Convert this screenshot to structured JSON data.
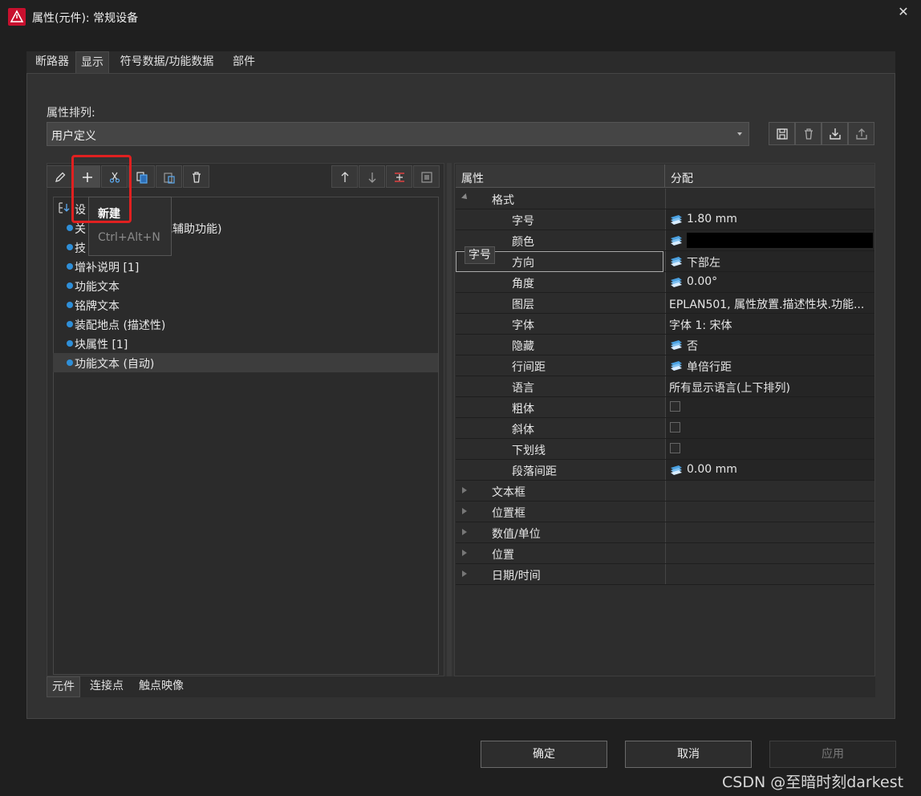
{
  "window": {
    "title": "属性(元件): 常规设备",
    "close": "✕"
  },
  "tabs": [
    "断路器",
    "显示",
    "符号数据/功能数据",
    "部件"
  ],
  "sort": {
    "label": "属性排列:",
    "value": "用户定义"
  },
  "tooltip": {
    "title": "新建",
    "shortcut": "Ctrl+Alt+N"
  },
  "tree": {
    "root_label": "设",
    "items": [
      "关",
      "技",
      "增补说明 [1]",
      "功能文本",
      "铭牌文本",
      "装配地点 (描述性)",
      "块属性 [1]",
      "功能文本 (自动)"
    ],
    "partial_item_suffix": "或辅助功能)"
  },
  "bottom_tabs": [
    "元件",
    "连接点",
    "触点映像"
  ],
  "grid": {
    "col_property": "属性",
    "col_value": "分配",
    "hover_tip": "字号",
    "rows": [
      {
        "name": "格式",
        "value": ""
      },
      {
        "name": "字号",
        "value": "1.80 mm"
      },
      {
        "name": "颜色",
        "value": ""
      },
      {
        "name": "方向",
        "value": "下部左"
      },
      {
        "name": "角度",
        "value": "0.00°"
      },
      {
        "name": "图层",
        "value": "EPLAN501, 属性放置.描述性块.功能..."
      },
      {
        "name": "字体",
        "value": "字体 1: 宋体"
      },
      {
        "name": "隐藏",
        "value": "否"
      },
      {
        "name": "行间距",
        "value": "单倍行距"
      },
      {
        "name": "语言",
        "value": "所有显示语言(上下排列)"
      },
      {
        "name": "粗体",
        "value": ""
      },
      {
        "name": "斜体",
        "value": ""
      },
      {
        "name": "下划线",
        "value": ""
      },
      {
        "name": "段落间距",
        "value": "0.00 mm"
      },
      {
        "name": "文本框",
        "value": ""
      },
      {
        "name": "位置框",
        "value": ""
      },
      {
        "name": "数值/单位",
        "value": ""
      },
      {
        "name": "位置",
        "value": ""
      },
      {
        "name": "日期/时间",
        "value": ""
      }
    ]
  },
  "buttons": {
    "ok": "确定",
    "cancel": "取消",
    "apply": "应用"
  },
  "watermark": "CSDN @至暗时刻darkest"
}
